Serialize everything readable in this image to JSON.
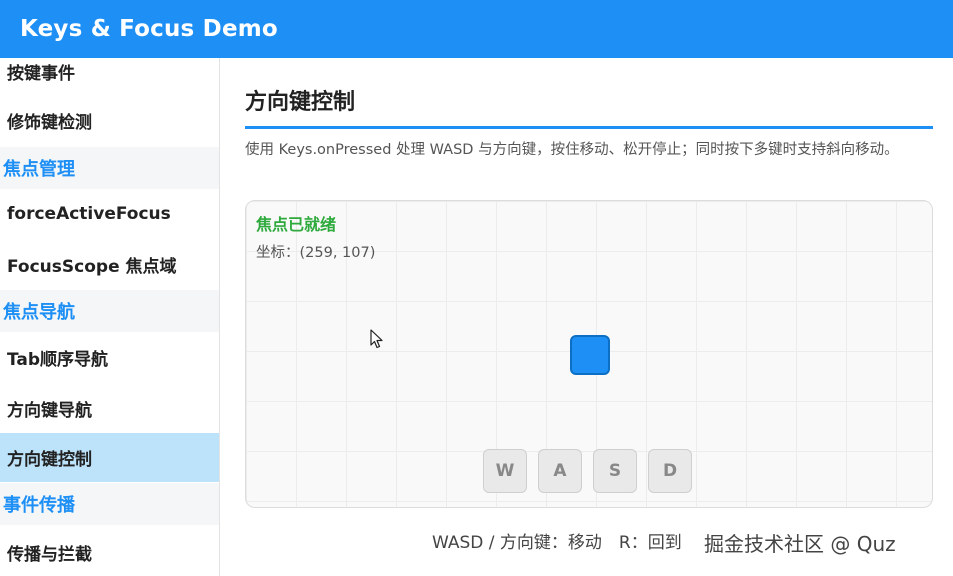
{
  "window": {
    "title": "Keys & Focus Demo"
  },
  "sidebar": {
    "items": [
      {
        "label": "按键事件"
      },
      {
        "label": "修饰键检测"
      },
      {
        "label": "焦点管理"
      },
      {
        "label": "forceActiveFocus"
      },
      {
        "label": "FocusScope 焦点域"
      },
      {
        "label": "焦点导航"
      },
      {
        "label": "Tab顺序导航"
      },
      {
        "label": "方向键导航"
      },
      {
        "label": "方向键控制"
      },
      {
        "label": "事件传播"
      },
      {
        "label": "传播与拦截"
      }
    ],
    "active": "方向键控制"
  },
  "main": {
    "title": "方向键控制",
    "description": "使用 Keys.onPressed 处理 WASD 与方向键，按住移动、松开停止；同时按下多键时支持斜向移动。",
    "playfield": {
      "status": "焦点已就绪",
      "coordinates": "坐标：(259, 107)",
      "keys": [
        "W",
        "A",
        "S",
        "D"
      ]
    },
    "footer_hint": "WASD / 方向键：移动　R：回到"
  },
  "watermark": "掘金技术社区 @ Quz",
  "colors": {
    "accent": "#1e90f5",
    "active_item_bg": "#bde3fb",
    "status_green": "#2eaa3c"
  },
  "icons": {
    "cursor": "mouse-pointer-icon"
  }
}
